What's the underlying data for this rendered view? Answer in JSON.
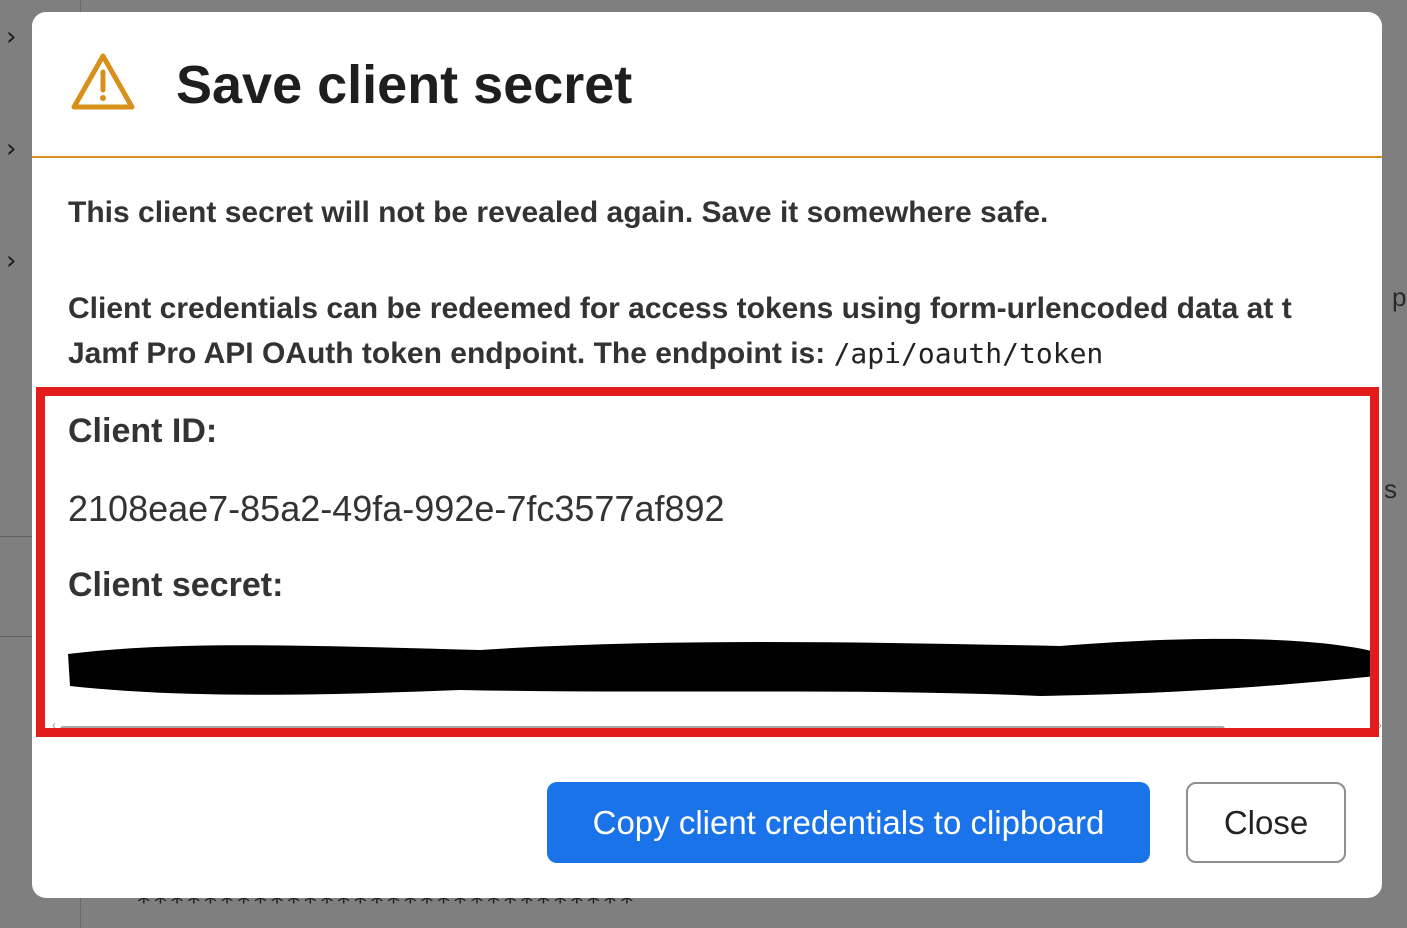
{
  "background": {
    "masked_value": "******************************",
    "fragments": [
      "p",
      "s"
    ]
  },
  "modal": {
    "title": "Save client secret",
    "title_icon": "warning-icon",
    "accent_color": "#d7901a",
    "warning_text": "This client secret will not be revealed again. Save it somewhere safe.",
    "info_line1": "Client credentials can be redeemed for access tokens using form-urlencoded data at t",
    "info_line2": "Jamf Pro API OAuth token endpoint. The endpoint is: ",
    "endpoint": "/api/oauth/token",
    "client_id_label": "Client ID:",
    "client_id_value": "2108eae7-85a2-49fa-992e-7fc3577af892",
    "client_secret_label": "Client secret:",
    "client_secret_redacted": true,
    "copy_button_label": "Copy client credentials to clipboard",
    "close_button_label": "Close",
    "primary_color": "#1a73e8"
  },
  "annotation": {
    "highlight_color": "#e21b1b"
  }
}
